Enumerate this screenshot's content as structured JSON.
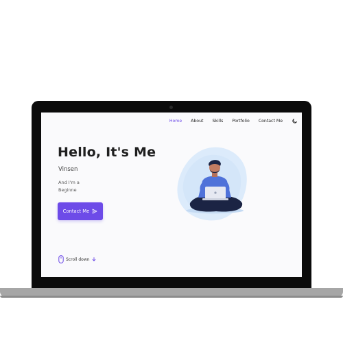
{
  "nav": {
    "items": [
      {
        "label": "Home",
        "active": true
      },
      {
        "label": "About"
      },
      {
        "label": "Skills"
      },
      {
        "label": "Portfolio"
      },
      {
        "label": "Contact Me"
      }
    ],
    "theme_icon": "moon-icon"
  },
  "hero": {
    "title": "Hello, It's Me",
    "name": "Vinsen",
    "intro_line1": "And I'm a",
    "intro_line2": "Beginne",
    "button_label": "Contact Me",
    "button_icon": "send-icon"
  },
  "scroll": {
    "label": "Scroll down",
    "icon": "mouse-icon",
    "arrow_icon": "arrow-down-icon"
  },
  "colors": {
    "accent": "#6d4be8",
    "screen_bg": "#fafafc",
    "blob": "#dcebfb"
  }
}
